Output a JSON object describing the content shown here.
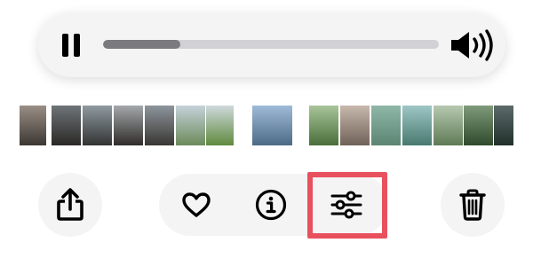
{
  "player": {
    "progress_fraction": 0.23,
    "pause_icon": "pause-icon",
    "volume_icon": "speaker-wave-icon"
  },
  "thumbnail_strip": {
    "thumbnails": [
      {
        "name": "photo-concert-edge",
        "top": "#9a8f86",
        "bottom": "#3d3733"
      },
      {
        "name": "photo-concert-crowd-1",
        "top": "#6e7478",
        "bottom": "#2b2826"
      },
      {
        "name": "photo-concert-stage-1",
        "top": "#8f9aa0",
        "bottom": "#333"
      },
      {
        "name": "photo-concert-stage-2",
        "top": "#a3a8aa",
        "bottom": "#2f2c2a"
      },
      {
        "name": "photo-concert-stage-3",
        "top": "#8c959b",
        "bottom": "#3a3633"
      },
      {
        "name": "photo-hillside-1",
        "top": "#c5d2da",
        "bottom": "#6c8a5a"
      },
      {
        "name": "photo-hillside-2",
        "top": "#cfd9dc",
        "bottom": "#5f8a3e"
      },
      {
        "name": "photo-temple",
        "top": "#d4dde0",
        "bottom": "#9d4a40"
      },
      {
        "name": "photo-bridge",
        "top": "#9fbbd8",
        "bottom": "#4c6a86"
      },
      {
        "name": "photo-trees",
        "top": "#a8c59a",
        "bottom": "#4a6e3a"
      },
      {
        "name": "photo-selfie-1",
        "top": "#c8b8ad",
        "bottom": "#6f6258"
      },
      {
        "name": "photo-selfie-2",
        "top": "#8fb7a8",
        "bottom": "#5b8573"
      },
      {
        "name": "photo-selfie-3",
        "top": "#9fc6c6",
        "bottom": "#487a6f"
      },
      {
        "name": "photo-field",
        "top": "#b6c9b0",
        "bottom": "#5f7a55"
      },
      {
        "name": "photo-forest",
        "top": "#7f9a7a",
        "bottom": "#2f4a2c"
      },
      {
        "name": "photo-night-trees",
        "top": "#5c6a6a",
        "bottom": "#20302a"
      },
      {
        "name": "photo-portrait",
        "top": "#a7a89b",
        "bottom": "#4f5248"
      },
      {
        "name": "photo-edge-right",
        "top": "#c9d0d3",
        "bottom": "#8b9598"
      }
    ]
  },
  "toolbar": {
    "share_icon": "share-icon",
    "favorite_icon": "heart-icon",
    "info_icon": "info-icon",
    "adjust_icon": "sliders-icon",
    "delete_icon": "trash-icon",
    "highlight_color": "#e9505e"
  }
}
